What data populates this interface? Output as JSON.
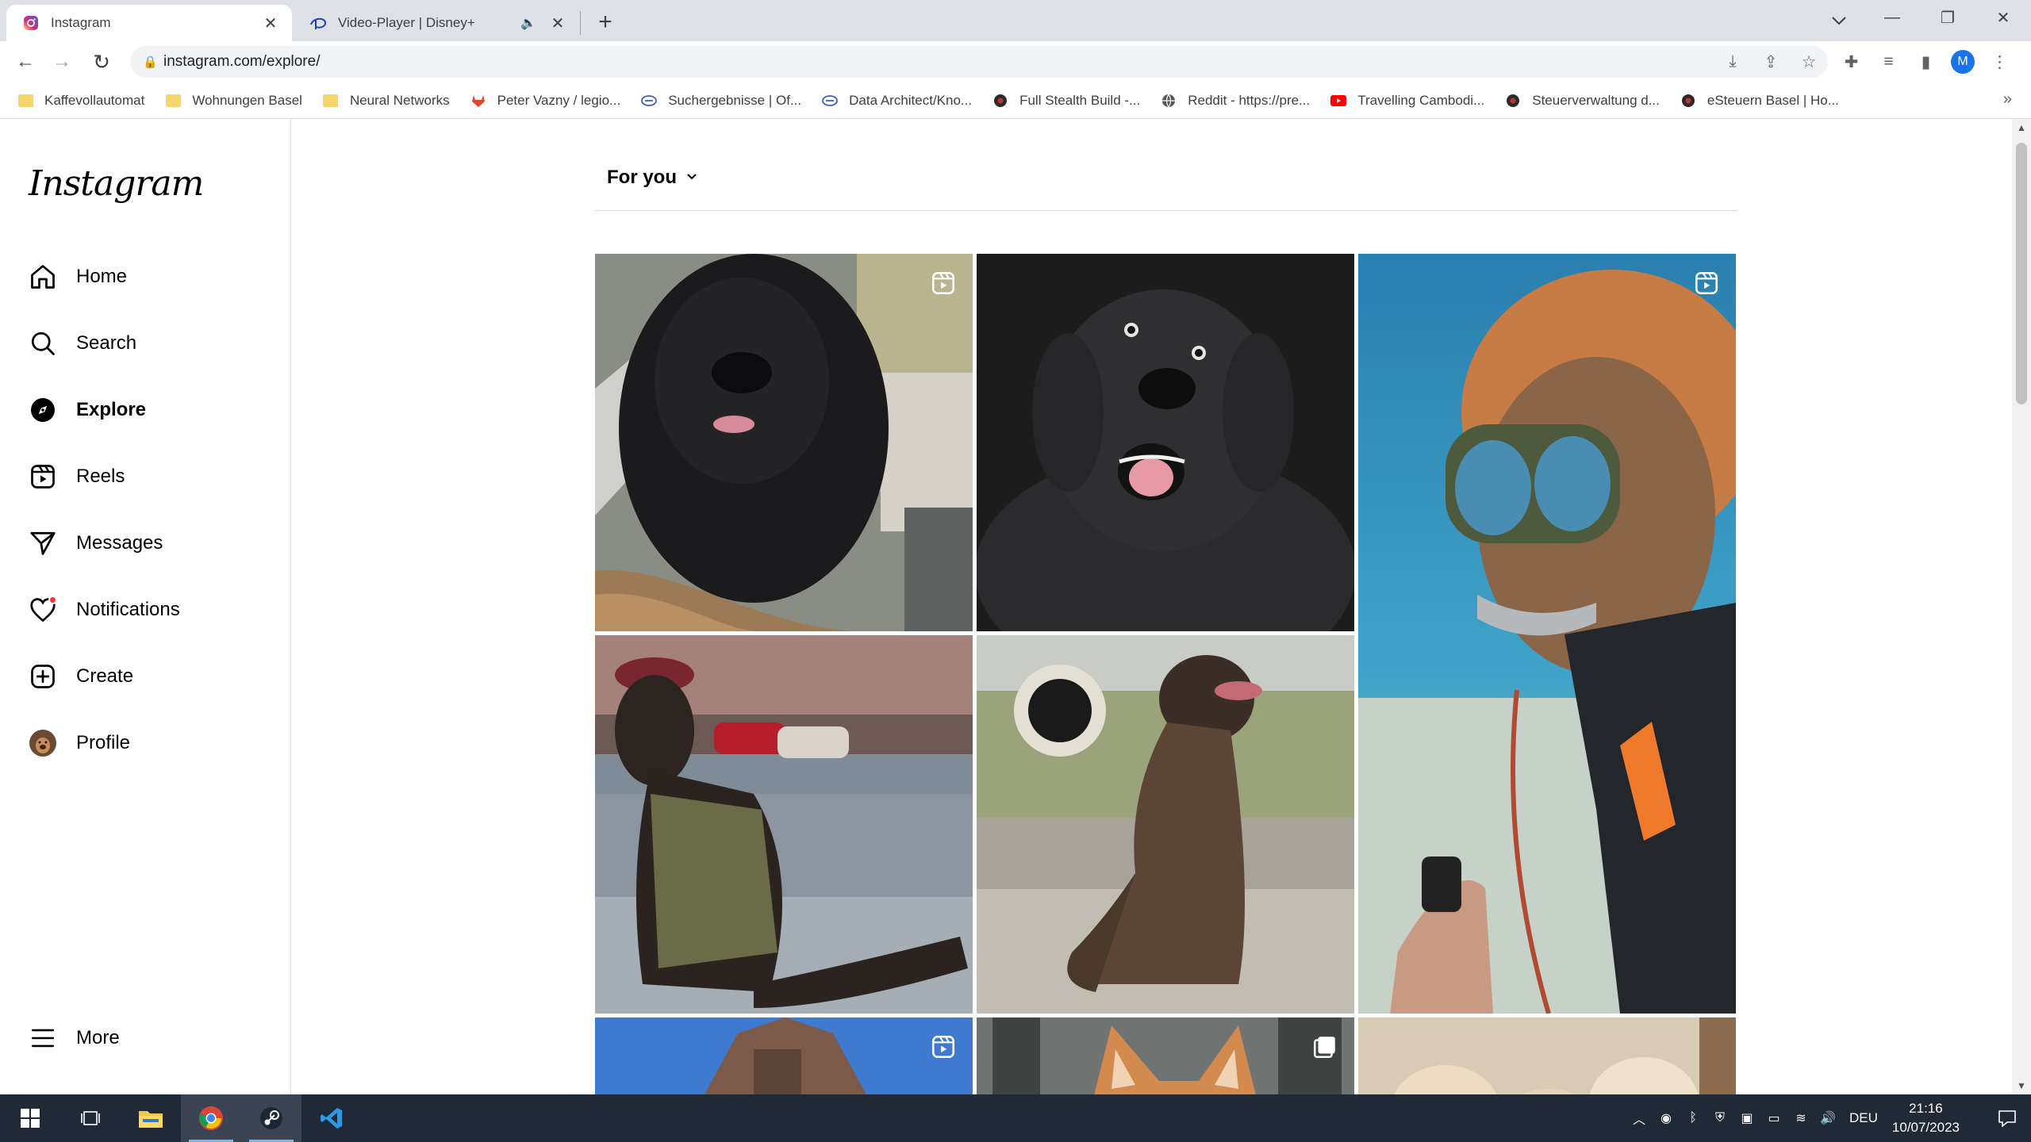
{
  "browser": {
    "tabs": [
      {
        "title": "Instagram",
        "active": true
      },
      {
        "title": "Video-Player | Disney+",
        "active": false
      }
    ],
    "url": "instagram.com/explore/",
    "profile_initial": "M",
    "bookmarks": [
      {
        "label": "Kaffevollautomat",
        "icon": "folder-icon"
      },
      {
        "label": "Wohnungen Basel",
        "icon": "folder-icon"
      },
      {
        "label": "Neural Networks",
        "icon": "folder-icon"
      },
      {
        "label": "Peter Vazny / legio...",
        "icon": "gitlab-icon"
      },
      {
        "label": "Suchergebnisse | Of...",
        "icon": "link-icon"
      },
      {
        "label": "Data Architect/Kno...",
        "icon": "link-icon"
      },
      {
        "label": "Full Stealth Build -...",
        "icon": "site-icon"
      },
      {
        "label": "Reddit - https://pre...",
        "icon": "globe-icon"
      },
      {
        "label": "Travelling Cambodi...",
        "icon": "youtube-icon"
      },
      {
        "label": "Steuerverwaltung d...",
        "icon": "site-icon"
      },
      {
        "label": "eSteuern Basel | Ho...",
        "icon": "site-icon"
      }
    ]
  },
  "instagram": {
    "logo": "Instagram",
    "nav": [
      {
        "label": "Home",
        "icon": "home-icon"
      },
      {
        "label": "Search",
        "icon": "search-icon"
      },
      {
        "label": "Explore",
        "icon": "compass-icon"
      },
      {
        "label": "Reels",
        "icon": "reels-icon"
      },
      {
        "label": "Messages",
        "icon": "messages-icon"
      },
      {
        "label": "Notifications",
        "icon": "heart-icon"
      },
      {
        "label": "Create",
        "icon": "plus-square-icon"
      },
      {
        "label": "Profile",
        "icon": "avatar"
      }
    ],
    "more": "More",
    "feed_label": "For you"
  },
  "taskbar": {
    "language": "DEU",
    "time": "21:16",
    "date": "10/07/2023"
  },
  "colors": {
    "ig_text": "#000000",
    "notification_dot": "#ff3040",
    "taskbar_bg": "#202a36"
  }
}
